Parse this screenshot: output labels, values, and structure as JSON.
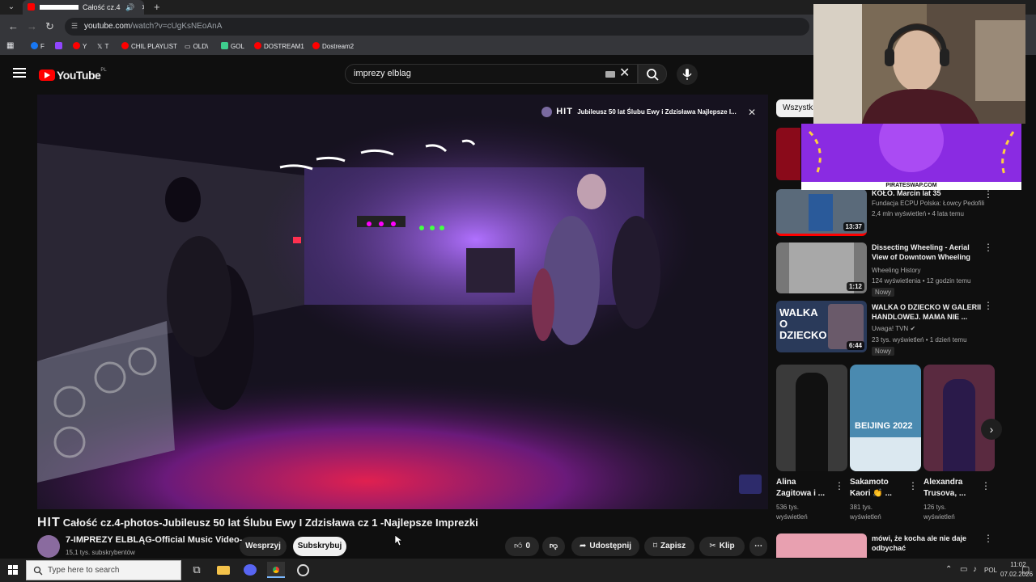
{
  "browser": {
    "tab_title": "Całość cz.4",
    "url_host": "youtube.com",
    "url_path": "/watch?v=cUgKsNEoAnA",
    "bookmarks": [
      {
        "label": "F",
        "color": "#1877f2"
      },
      {
        "label": "",
        "color": "#9146ff"
      },
      {
        "label": "Y",
        "color": "#ff0000"
      },
      {
        "label": "T",
        "color": "#ffffff"
      },
      {
        "label": "CHIL PLAYLIST",
        "color": "#ff0000"
      },
      {
        "label": "OLD\\",
        "color": "#cccccc"
      },
      {
        "label": "GOL",
        "color": "#3ecf8e"
      },
      {
        "label": "DOSTREAM1",
        "color": "#ff0000"
      },
      {
        "label": "Dostream2",
        "color": "#ff0000"
      }
    ]
  },
  "yt": {
    "logo": "YouTube",
    "region": "PL",
    "search_query": "imprezy elblag"
  },
  "player": {
    "overlay_brand": "HIT",
    "overlay_title": "Jubileusz 50 lat Ślubu Ewy i Zdzisława Najlepsze I..."
  },
  "video": {
    "title_prefix": "HIT",
    "title": "Całość cz.4-photos-Jubileusz 50 lat Ślubu Ewy I Zdzisława cz 1 -Najlepsze Imprezki",
    "channel": "7-IMPREZY ELBLĄG-Official Music Video-",
    "subscribers": "15,1 tys. subskrybentów",
    "support_label": "Wesprzyj",
    "subscribe_label": "Subskrybuj",
    "likes": "0",
    "share_label": "Udostępnij",
    "save_label": "Zapisz",
    "clip_label": "Klip"
  },
  "sidebar": {
    "chip": "Wszystki",
    "items": [
      {
        "title": "KOŁO. Marcin lat 35",
        "channel": "Fundacja ECPU Polska: Łowcy Pedofili",
        "meta": "2,4 mln wyświetleń • 4 lata temu",
        "duration": "13:37",
        "badge": ""
      },
      {
        "title": "Dissecting Wheeling - Aerial View of Downtown Wheeling",
        "channel": "Wheeling History",
        "meta": "124 wyświetlenia • 12 godzin temu",
        "duration": "1:12",
        "badge": "Nowy"
      },
      {
        "title": "WALKA O DZIECKO W GALERII HANDLOWEJ. MAMA NIE ...",
        "channel": "Uwaga! TVN",
        "meta": "23 tys. wyświetleń • 1 dzień temu",
        "duration": "6:44",
        "badge": "Nowy",
        "thumb_text": "WALKA O DZIECKO"
      },
      {
        "title": "mówi, że kocha ale nie daje odbychać",
        "channel": "",
        "meta": "",
        "duration": "",
        "badge": ""
      }
    ],
    "shorts": [
      {
        "title1": "Alina",
        "title2": "Zagitowa i ...",
        "views1": "536 tys.",
        "views2": "wyświetleń"
      },
      {
        "title1": "Sakamoto",
        "title2": "Kaori 👏 ...",
        "views1": "381 tys.",
        "views2": "wyświetleń",
        "thumb_text": "BEIJING 2022"
      },
      {
        "title1": "Alexandra",
        "title2": "Trusova, ...",
        "views1": "126 tys.",
        "views2": "wyświetleń"
      }
    ]
  },
  "stream": {
    "sponsor": "PIRATESWAP.COM"
  },
  "taskbar": {
    "search_placeholder": "Type here to search",
    "lang": "POL",
    "time": "11:02",
    "date": "07.02.2026"
  },
  "colors": {
    "yt_red": "#ff0000",
    "background": "#0f0f0f",
    "purple_banner": "#8a2be2"
  }
}
